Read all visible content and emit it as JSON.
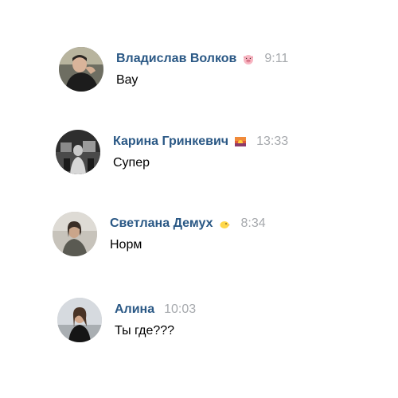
{
  "messages": [
    {
      "author": "Владислав Волков",
      "emoji_icon": "pig-face-icon",
      "time": "9:11",
      "text": "Вау"
    },
    {
      "author": "Карина Гринкевич",
      "emoji_icon": "sunset-icon",
      "time": "13:33",
      "text": "Супер"
    },
    {
      "author": "Светлана Демух",
      "emoji_icon": "chick-icon",
      "time": "8:34",
      "text": "Норм"
    },
    {
      "author": "Алина",
      "emoji_icon": "",
      "time": "10:03",
      "text": "Ты где???"
    }
  ],
  "colors": {
    "author": "#2a5885",
    "time": "#a6a9ad",
    "text": "#000000"
  }
}
